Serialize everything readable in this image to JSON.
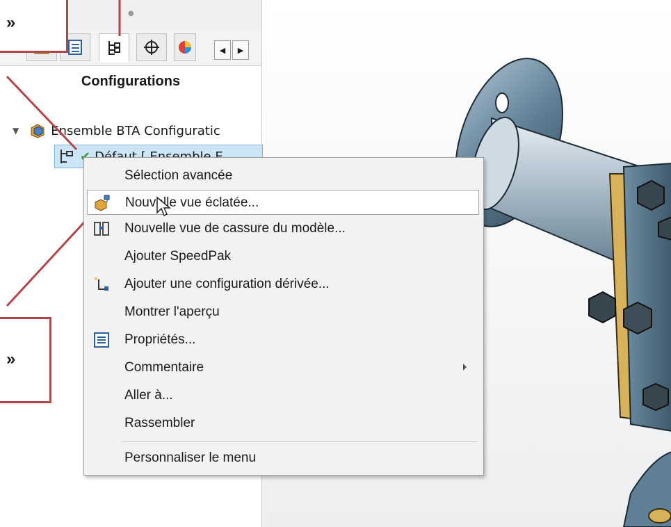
{
  "panel": {
    "title": "Configurations",
    "tabs": [
      {
        "icon": "parts-icon"
      },
      {
        "icon": "property-manager-icon"
      },
      {
        "icon": "configuration-manager-icon",
        "active": true
      },
      {
        "icon": "dimxpert-icon"
      },
      {
        "icon": "display-manager-icon"
      }
    ],
    "tree": {
      "root_label": "Ensemble BTA Configuratic",
      "child_label": "Défaut [ Ensemble E"
    }
  },
  "callouts": {
    "top_text": "»",
    "bottom_text": "»"
  },
  "context_menu": {
    "items": [
      {
        "label": "Sélection avancée",
        "icon": null
      },
      {
        "label": "Nouvelle vue éclatée...",
        "icon": "exploded-view-icon",
        "hover": true
      },
      {
        "label": "Nouvelle vue de cassure du modèle...",
        "icon": "model-break-view-icon"
      },
      {
        "label": "Ajouter SpeedPak",
        "icon": null
      },
      {
        "label": "Ajouter une configuration dérivée...",
        "icon": "derived-configuration-icon"
      },
      {
        "label": "Montrer l'aperçu",
        "icon": null
      },
      {
        "label": "Propriétés...",
        "icon": "properties-icon"
      },
      {
        "label": "Commentaire",
        "icon": null,
        "submenu": true
      },
      {
        "label": "Aller à...",
        "icon": null
      },
      {
        "label": "Rassembler",
        "icon": null
      },
      {
        "label": "Personnaliser le menu",
        "icon": null
      }
    ]
  },
  "colors": {
    "callout_border": "#b0454a",
    "selection_fill": "#cde6f7",
    "flange_blue": "#4f6f86",
    "gasket_gold": "#d8b25a"
  }
}
